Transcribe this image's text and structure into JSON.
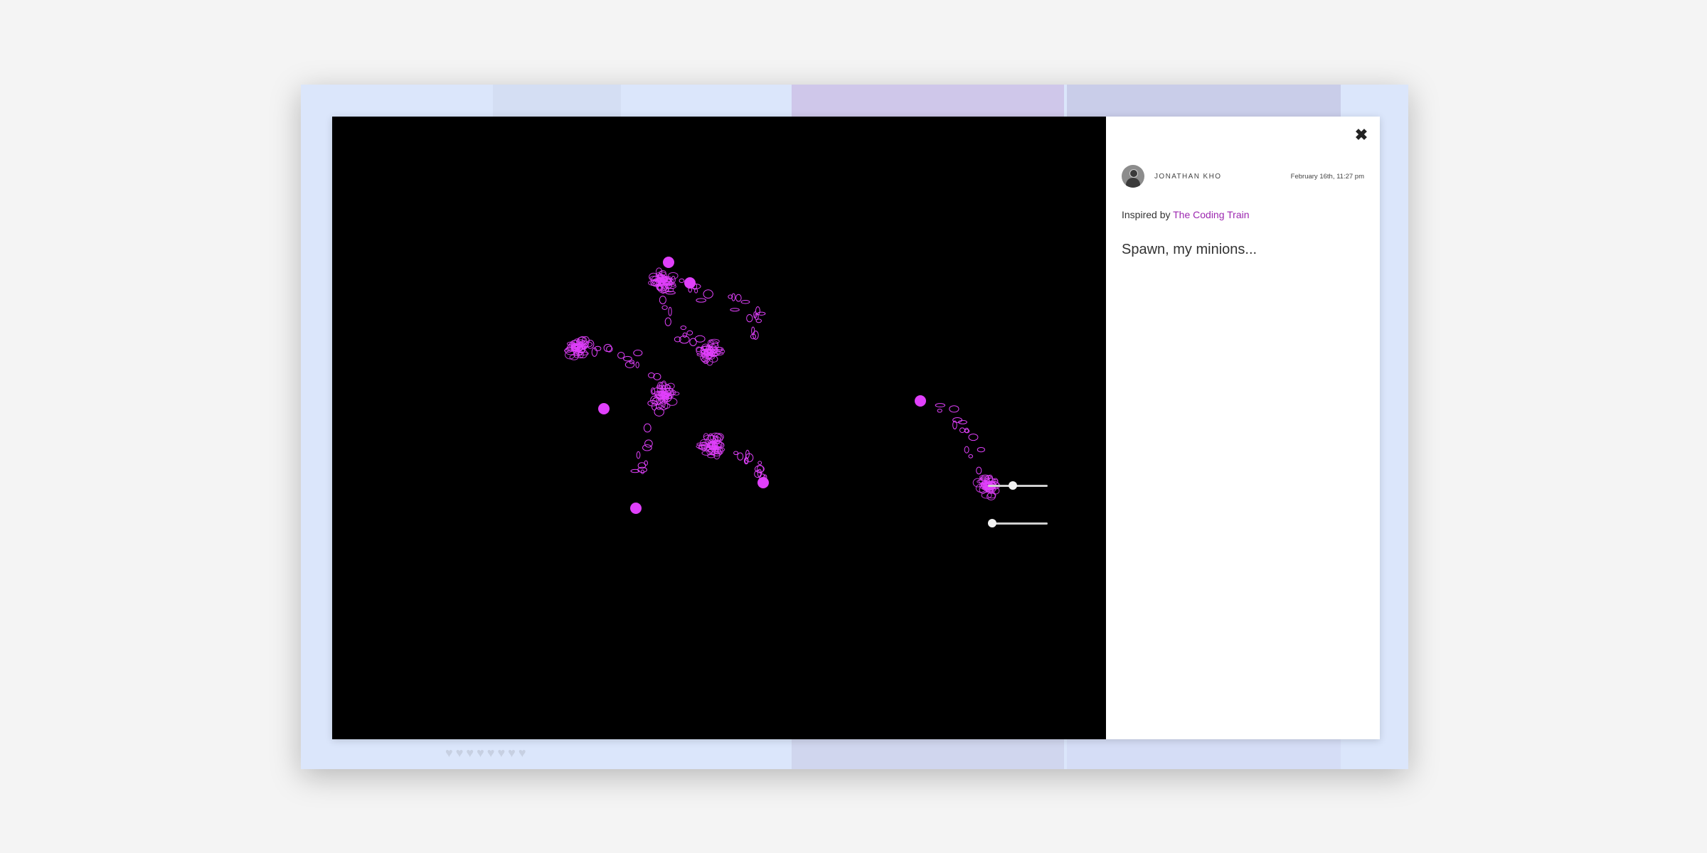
{
  "post": {
    "author": "JONATHAN KHO",
    "date": "February 16th, 11:27 pm",
    "inspired_prefix": "Inspired by ",
    "inspired_link": "The Coding Train",
    "title": "Spawn, my minions..."
  },
  "controls": {
    "close_icon": "✖",
    "slider1_value": 0.4,
    "slider2_value": 0.0
  },
  "colors": {
    "accent": "#9c27b0",
    "particle": "#e040fb",
    "canvas_bg": "#000000"
  },
  "icons": [
    "close-icon",
    "avatar-icon"
  ]
}
